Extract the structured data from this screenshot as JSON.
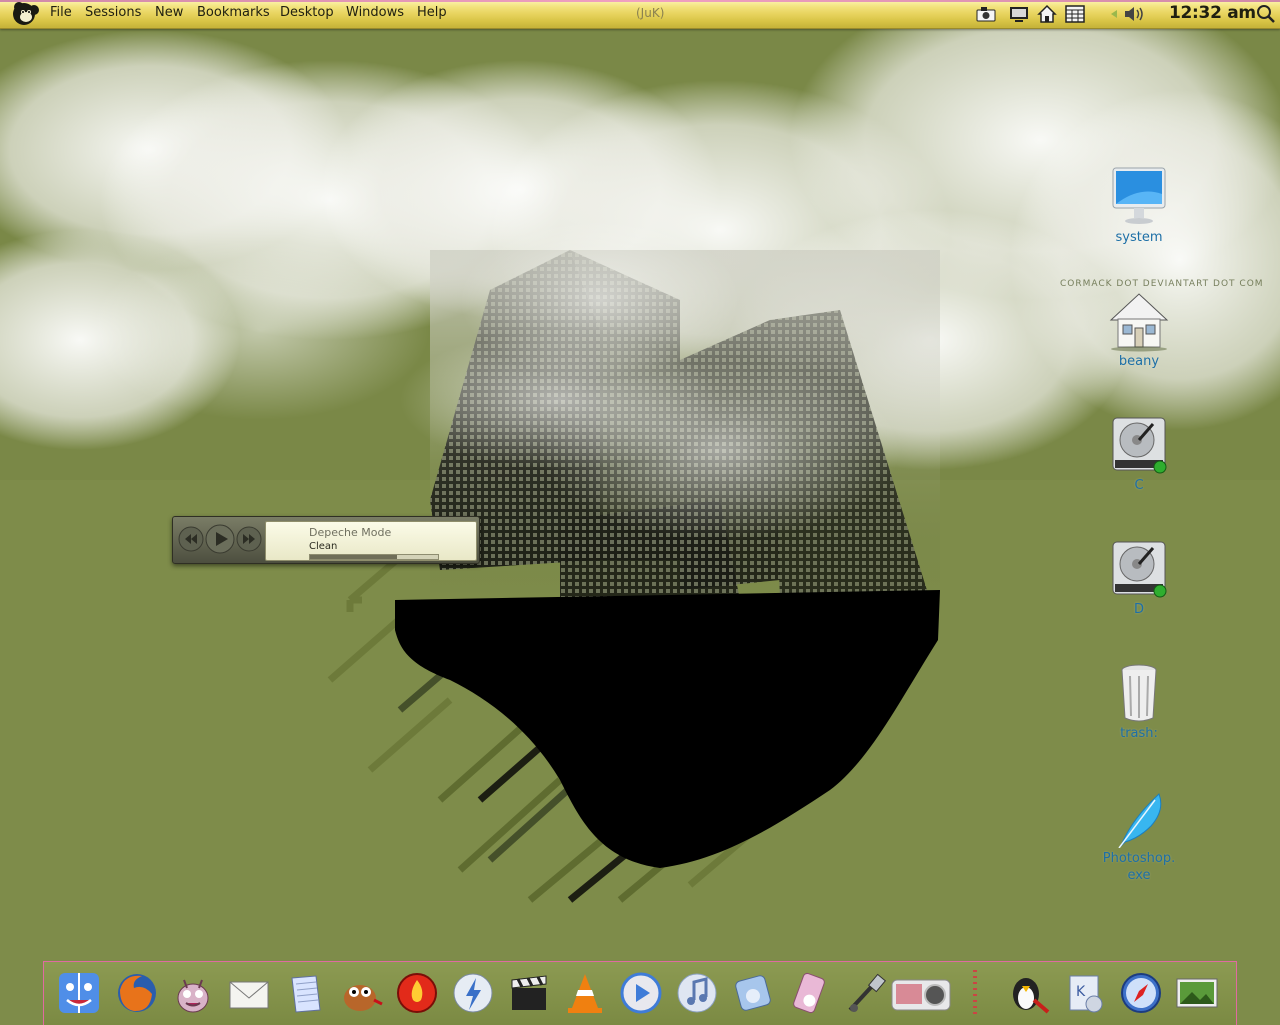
{
  "menubar": {
    "menus": [
      "File",
      "Sessions",
      "New",
      "Bookmarks",
      "Desktop",
      "Windows",
      "Help"
    ],
    "window_title": "(JuK)",
    "tray_icons": [
      "camera-icon",
      "monitor-icon",
      "home-icon",
      "calculator-icon",
      "volume-icon"
    ],
    "clock": "12:32 am",
    "search_icon": "magnifier-icon"
  },
  "player": {
    "artist": "Depeche Mode",
    "track": "Clean",
    "progress": 0.68
  },
  "desktop_icons": [
    {
      "label": "system",
      "icon": "computer-icon"
    },
    {
      "label": "beany",
      "icon": "home-folder-icon"
    },
    {
      "label": "C",
      "icon": "hard-drive-icon"
    },
    {
      "label": "D",
      "icon": "hard-drive-icon"
    },
    {
      "label": "trash:",
      "icon": "trash-icon"
    },
    {
      "label": "Photoshop.",
      "label2": "exe",
      "icon": "feather-icon"
    }
  ],
  "watermark": "CORMACK DOT DEVIANTART DOT COM",
  "dock": {
    "items": [
      "finder-face-icon",
      "firefox-icon",
      "creature-icon",
      "mail-icon",
      "notes-icon",
      "gimp-icon",
      "burner-icon",
      "kopete-icon",
      "film-clapper-icon",
      "vlc-cone-icon",
      "media-player-icon",
      "itunes-icon",
      "music-device-icon",
      "ipod-icon",
      "usb-cable-icon",
      "camera-device-icon",
      "penguin-tools-icon",
      "control-center-icon",
      "safari-compass-icon",
      "photo-viewer-icon"
    ]
  },
  "colors": {
    "background": "#7e8c4a",
    "menubar": "#e7d35e",
    "icon_label": "#1d6fa6",
    "dock_border": "#e06aa0"
  }
}
